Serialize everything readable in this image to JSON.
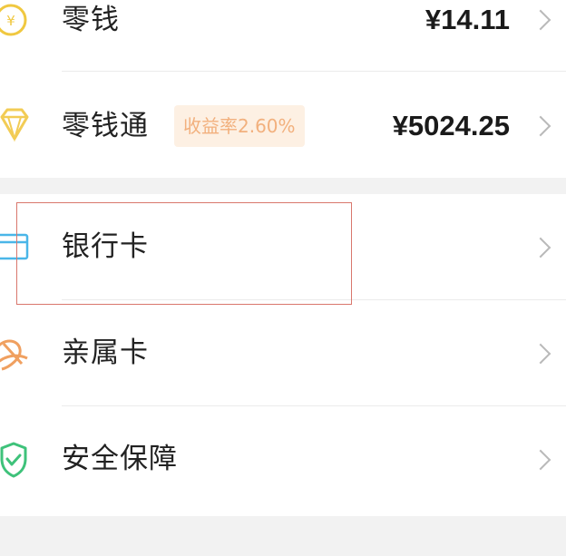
{
  "wallet": {
    "items": [
      {
        "label": "零钱",
        "amount": "¥14.11",
        "icon": "yuan-coin-icon"
      },
      {
        "label": "零钱通",
        "amount": "¥5024.25",
        "badge": "收益率2.60%",
        "icon": "diamond-icon"
      },
      {
        "label": "银行卡",
        "icon": "bank-card-icon"
      },
      {
        "label": "亲属卡",
        "icon": "family-card-icon"
      },
      {
        "label": "安全保障",
        "icon": "shield-icon"
      }
    ]
  },
  "colors": {
    "background": "#f2f2f2",
    "card": "#ffffff",
    "coin": "#f0c840",
    "diamond": "#f2cc55",
    "bank_card": "#4ab6e8",
    "family_card": "#f0a060",
    "shield": "#3ec27a",
    "badge_bg": "#fdf0e3",
    "badge_text": "#f2b07d",
    "highlight": "#d9776d"
  }
}
